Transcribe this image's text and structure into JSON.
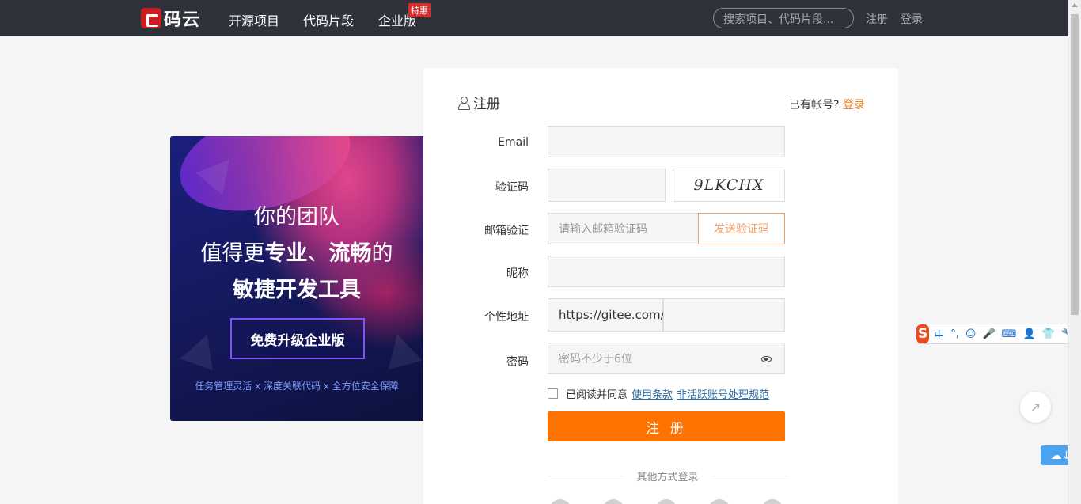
{
  "nav": {
    "logo": "码云",
    "items": [
      "开源项目",
      "代码片段",
      "企业版"
    ],
    "badge": "特惠",
    "search_placeholder": "搜索项目、代码片段...",
    "register": "注册",
    "login": "登录"
  },
  "banner": {
    "line1": "你的团队",
    "line2_pre": "值得更",
    "line2_strong1": "专业",
    "line2_sep": "、",
    "line2_strong2": "流畅",
    "line2_post": "的",
    "line3": "敏捷开发工具",
    "button": "免费升级企业版",
    "features": "任务管理灵活 x 深度关联代码  x 全方位安全保障"
  },
  "form": {
    "title": "注册",
    "have_account": "已有帐号? ",
    "login_link": "登录",
    "email_label": "Email",
    "captcha_label": "验证码",
    "captcha_text": "9LKCHX",
    "email_verify_label": "邮箱验证",
    "email_verify_placeholder": "请输入邮箱验证码",
    "send_code": "发送验证码",
    "nickname_label": "昵称",
    "url_label": "个性地址",
    "url_prefix": "https://gitee.com/",
    "password_label": "密码",
    "password_placeholder": "密码不少于6位",
    "agree_text": "已阅读并同意",
    "terms_link": "使用条款",
    "policy_link": "非活跃账号处理规范",
    "submit": "注 册",
    "other_login": "其他方式登录"
  },
  "ime": {
    "logo": "S",
    "items": [
      "中",
      "°,",
      "☺",
      "🎤",
      "⌨",
      "👤",
      "👕",
      "🔧"
    ]
  },
  "colors": {
    "primary": "#fe7300",
    "nav_bg": "#2f323a",
    "link": "#e67e22"
  }
}
